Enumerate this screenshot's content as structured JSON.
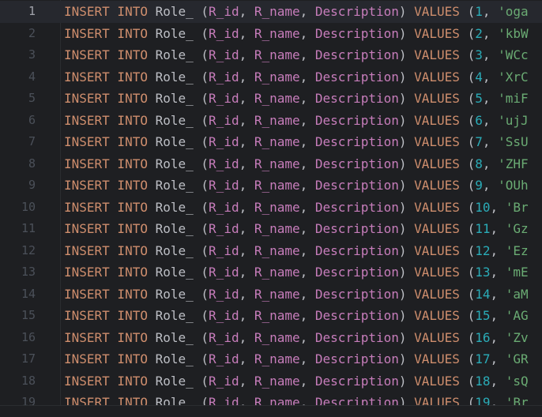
{
  "editor": {
    "lines": [
      {
        "num": "1",
        "kw1": "INSERT INTO",
        "table": "Role_",
        "c1": "R_id",
        "c2": "R_name",
        "c3": "Description",
        "kw2": "VALUES",
        "val": "1",
        "str": "'oga"
      },
      {
        "num": "2",
        "kw1": "INSERT INTO",
        "table": "Role_",
        "c1": "R_id",
        "c2": "R_name",
        "c3": "Description",
        "kw2": "VALUES",
        "val": "2",
        "str": "'kbW"
      },
      {
        "num": "3",
        "kw1": "INSERT INTO",
        "table": "Role_",
        "c1": "R_id",
        "c2": "R_name",
        "c3": "Description",
        "kw2": "VALUES",
        "val": "3",
        "str": "'WCc"
      },
      {
        "num": "4",
        "kw1": "INSERT INTO",
        "table": "Role_",
        "c1": "R_id",
        "c2": "R_name",
        "c3": "Description",
        "kw2": "VALUES",
        "val": "4",
        "str": "'XrC"
      },
      {
        "num": "5",
        "kw1": "INSERT INTO",
        "table": "Role_",
        "c1": "R_id",
        "c2": "R_name",
        "c3": "Description",
        "kw2": "VALUES",
        "val": "5",
        "str": "'miF"
      },
      {
        "num": "6",
        "kw1": "INSERT INTO",
        "table": "Role_",
        "c1": "R_id",
        "c2": "R_name",
        "c3": "Description",
        "kw2": "VALUES",
        "val": "6",
        "str": "'ujJ"
      },
      {
        "num": "7",
        "kw1": "INSERT INTO",
        "table": "Role_",
        "c1": "R_id",
        "c2": "R_name",
        "c3": "Description",
        "kw2": "VALUES",
        "val": "7",
        "str": "'SsU"
      },
      {
        "num": "8",
        "kw1": "INSERT INTO",
        "table": "Role_",
        "c1": "R_id",
        "c2": "R_name",
        "c3": "Description",
        "kw2": "VALUES",
        "val": "8",
        "str": "'ZHF"
      },
      {
        "num": "9",
        "kw1": "INSERT INTO",
        "table": "Role_",
        "c1": "R_id",
        "c2": "R_name",
        "c3": "Description",
        "kw2": "VALUES",
        "val": "9",
        "str": "'OUh"
      },
      {
        "num": "10",
        "kw1": "INSERT INTO",
        "table": "Role_",
        "c1": "R_id",
        "c2": "R_name",
        "c3": "Description",
        "kw2": "VALUES",
        "val": "10",
        "str": "'Br"
      },
      {
        "num": "11",
        "kw1": "INSERT INTO",
        "table": "Role_",
        "c1": "R_id",
        "c2": "R_name",
        "c3": "Description",
        "kw2": "VALUES",
        "val": "11",
        "str": "'Gz"
      },
      {
        "num": "12",
        "kw1": "INSERT INTO",
        "table": "Role_",
        "c1": "R_id",
        "c2": "R_name",
        "c3": "Description",
        "kw2": "VALUES",
        "val": "12",
        "str": "'Ez"
      },
      {
        "num": "13",
        "kw1": "INSERT INTO",
        "table": "Role_",
        "c1": "R_id",
        "c2": "R_name",
        "c3": "Description",
        "kw2": "VALUES",
        "val": "13",
        "str": "'mE"
      },
      {
        "num": "14",
        "kw1": "INSERT INTO",
        "table": "Role_",
        "c1": "R_id",
        "c2": "R_name",
        "c3": "Description",
        "kw2": "VALUES",
        "val": "14",
        "str": "'aM"
      },
      {
        "num": "15",
        "kw1": "INSERT INTO",
        "table": "Role_",
        "c1": "R_id",
        "c2": "R_name",
        "c3": "Description",
        "kw2": "VALUES",
        "val": "15",
        "str": "'AG"
      },
      {
        "num": "16",
        "kw1": "INSERT INTO",
        "table": "Role_",
        "c1": "R_id",
        "c2": "R_name",
        "c3": "Description",
        "kw2": "VALUES",
        "val": "16",
        "str": "'Zv"
      },
      {
        "num": "17",
        "kw1": "INSERT INTO",
        "table": "Role_",
        "c1": "R_id",
        "c2": "R_name",
        "c3": "Description",
        "kw2": "VALUES",
        "val": "17",
        "str": "'GR"
      },
      {
        "num": "18",
        "kw1": "INSERT INTO",
        "table": "Role_",
        "c1": "R_id",
        "c2": "R_name",
        "c3": "Description",
        "kw2": "VALUES",
        "val": "18",
        "str": "'sQ"
      },
      {
        "num": "19",
        "kw1": "INSERT INTO",
        "table": "Role_",
        "c1": "R_id",
        "c2": "R_name",
        "c3": "Description",
        "kw2": "VALUES",
        "val": "19",
        "str": "'Br"
      }
    ],
    "current_line": "1",
    "colors": {
      "background": "#1e1f22",
      "keyword": "#cf8e6d",
      "column": "#c77dbb",
      "number": "#2aacb8",
      "string": "#6aab73",
      "identifier": "#bcbec4",
      "line_number": "#4b5059"
    }
  }
}
